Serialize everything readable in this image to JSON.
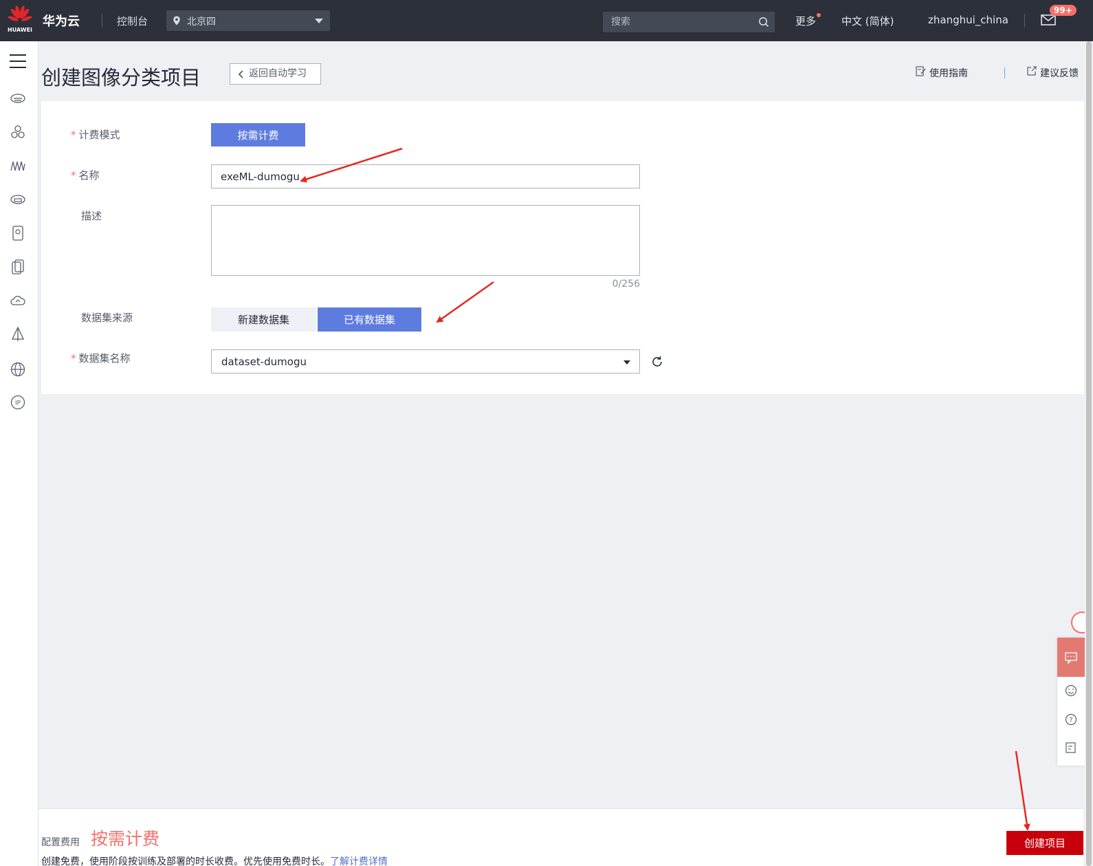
{
  "topbar": {
    "logo_text": "HUAWEI",
    "brand": "华为云",
    "console": "控制台",
    "region": "北京四",
    "search_placeholder": "搜索",
    "more": "更多",
    "language": "中文 (简体)",
    "username": "zhanghui_china",
    "badge": "99+"
  },
  "header": {
    "title": "创建图像分类项目",
    "back_label": "返回自动学习",
    "guide_label": "使用指南",
    "feedback_label": "建议反馈"
  },
  "form": {
    "billing_label": "计费模式",
    "billing_option": "按需计费",
    "name_label": "名称",
    "name_value": "exeML-dumogu",
    "desc_label": "描述",
    "desc_value": "",
    "desc_counter": "0/256",
    "source_label": "数据集来源",
    "source_new": "新建数据集",
    "source_existing": "已有数据集",
    "dataset_label": "数据集名称",
    "dataset_value": "dataset-dumogu"
  },
  "footer": {
    "config_label": "配置费用",
    "config_value": "按需计费",
    "note": "创建免费，使用阶段按训练及部署的时长收费。优先使用免费时长。",
    "note_link": "了解计费详情",
    "create_button": "创建项目"
  },
  "colors": {
    "topbar_bg": "#2b303b",
    "primary": "#5e7ce0",
    "danger": "#c7000b",
    "accent_red": "#f66f6a",
    "arrow": "#e8261d"
  },
  "rail_icons": [
    "menu-icon",
    "cloud-server-icon",
    "cluster-icon",
    "waveform-icon",
    "cloud-disk-icon",
    "storage-icon",
    "backup-icon",
    "cloud-icon",
    "pyramid-icon",
    "globe-icon",
    "ip-icon"
  ]
}
